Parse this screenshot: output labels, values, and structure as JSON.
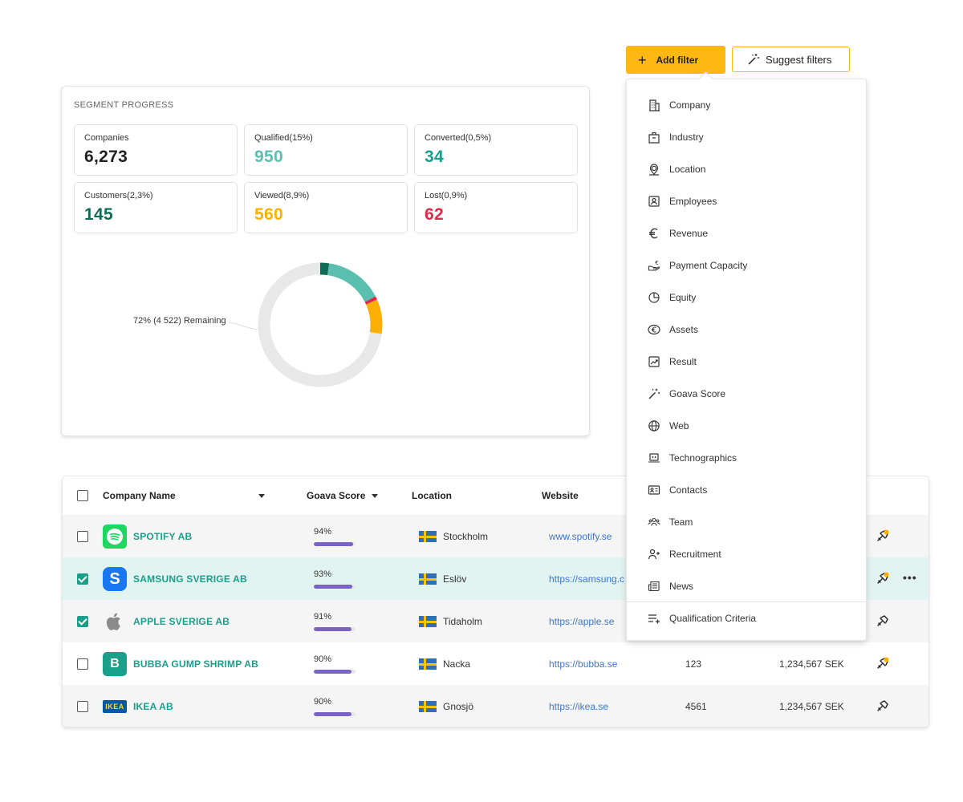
{
  "segment": {
    "title": "SEGMENT PROGRESS",
    "stats": [
      {
        "label": "Companies",
        "value": "6,273",
        "color": "#222222"
      },
      {
        "label": "Qualified(15%)",
        "value": "950",
        "color": "#5bbfb0"
      },
      {
        "label": "Converted(0,5%)",
        "value": "34",
        "color": "#17a08c"
      },
      {
        "label": "Customers(2,3%)",
        "value": "145",
        "color": "#0f6b55"
      },
      {
        "label": "Viewed(8,9%)",
        "value": "560",
        "color": "#fdb000"
      },
      {
        "label": "Lost(0,9%)",
        "value": "62",
        "color": "#e0284a"
      }
    ],
    "remaining_label": "72% (4 522) Remaining"
  },
  "chart_data": {
    "type": "pie",
    "categories": [
      "Customers",
      "Qualified",
      "Lost",
      "Viewed",
      "Remaining"
    ],
    "values": [
      2.3,
      15,
      0.9,
      8.9,
      72
    ],
    "colors": [
      "#0f6b55",
      "#5bbfb0",
      "#e0284a",
      "#fdb000",
      "#e8e8e8"
    ]
  },
  "filters": {
    "add_label": "Add filter",
    "suggest_label": "Suggest filters",
    "items": [
      {
        "label": "Company",
        "icon": "building-icon"
      },
      {
        "label": "Industry",
        "icon": "factory-icon"
      },
      {
        "label": "Location",
        "icon": "location-pin-icon"
      },
      {
        "label": "Employees",
        "icon": "person-card-icon"
      },
      {
        "label": "Revenue",
        "icon": "euro-icon"
      },
      {
        "label": "Payment Capacity",
        "icon": "hand-coin-icon"
      },
      {
        "label": "Equity",
        "icon": "pie-chart-icon"
      },
      {
        "label": "Assets",
        "icon": "euro-circle-icon"
      },
      {
        "label": "Result",
        "icon": "trend-chart-icon"
      },
      {
        "label": "Goava Score",
        "icon": "magic-wand-icon"
      },
      {
        "label": "Web",
        "icon": "globe-icon"
      },
      {
        "label": "Technographics",
        "icon": "laptop-code-icon"
      },
      {
        "label": "Contacts",
        "icon": "contact-card-icon"
      },
      {
        "label": "Team",
        "icon": "team-icon"
      },
      {
        "label": "Recruitment",
        "icon": "add-person-icon"
      },
      {
        "label": "News",
        "icon": "newspaper-icon"
      }
    ],
    "qualification_label": "Qualification Criteria"
  },
  "table": {
    "headers": {
      "company": "Company Name",
      "score": "Goava Score",
      "location": "Location",
      "website": "Website"
    },
    "rows": [
      {
        "name": "SPOTIFY AB",
        "logo": "spotify-logo",
        "logo_color": "#1ed760",
        "logo_text": "",
        "checked": false,
        "score": "94%",
        "score_value": 94,
        "location": "Stockholm",
        "website": "www.spotify.se",
        "employees": "",
        "revenue": "",
        "alert": true,
        "more": false
      },
      {
        "name": "SAMSUNG SVERIGE AB",
        "logo": "samsung-logo",
        "logo_color": "#1877f2",
        "logo_text": "S",
        "checked": true,
        "score": "93%",
        "score_value": 93,
        "location": "Eslöv",
        "website": "https://samsung.c",
        "employees": "",
        "revenue": "",
        "alert": true,
        "more": true
      },
      {
        "name": "APPLE SVERIGE AB",
        "logo": "apple-logo",
        "logo_color": "#8a8a8a",
        "logo_text": "",
        "checked": true,
        "score": "91%",
        "score_value": 91,
        "location": "Tidaholm",
        "website": "https://apple.se",
        "employees": "",
        "revenue": "",
        "alert": false,
        "more": false
      },
      {
        "name": "BUBBA GUMP SHRIMP AB",
        "logo": "bubba-logo",
        "logo_color": "#1a9f8a",
        "logo_text": "B",
        "checked": false,
        "score": "90%",
        "score_value": 90,
        "location": "Nacka",
        "website": "https://bubba.se",
        "employees": "123",
        "revenue": "1,234,567 SEK",
        "alert": true,
        "more": false
      },
      {
        "name": "IKEA AB",
        "logo": "ikea-logo",
        "logo_color": "#0058a3",
        "logo_text": "IKEA",
        "checked": false,
        "score": "90%",
        "score_value": 90,
        "location": "Gnosjö",
        "website": "https://ikea.se",
        "employees": "4561",
        "revenue": "1,234,567 SEK",
        "alert": false,
        "more": false
      }
    ]
  }
}
